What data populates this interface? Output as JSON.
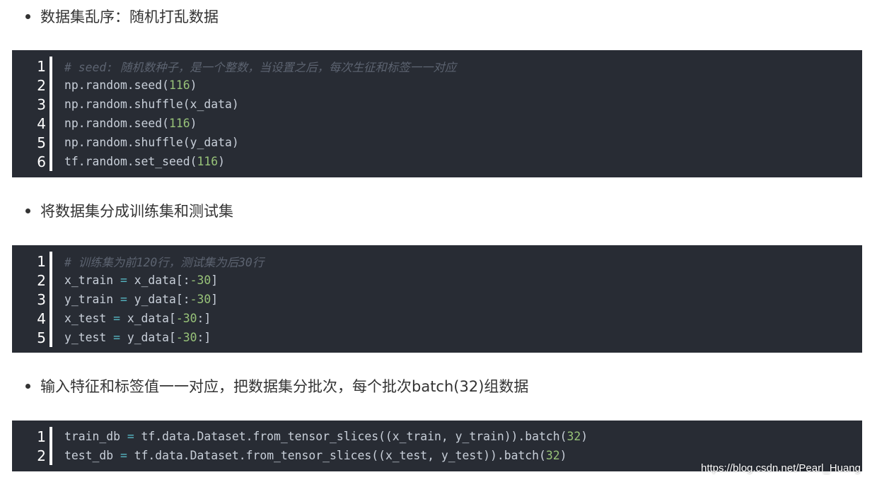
{
  "sections": [
    {
      "heading": "数据集乱序：随机打乱数据",
      "lines": [
        [
          {
            "t": "# seed: 随机数种子，是一个整数，当设置之后，每次生征和标签一一对应",
            "c": "comment"
          }
        ],
        [
          {
            "t": "np.random.seed("
          },
          {
            "t": "116",
            "c": "num"
          },
          {
            "t": ")"
          }
        ],
        [
          {
            "t": "np.random.shuffle(x_data)"
          }
        ],
        [
          {
            "t": "np.random.seed("
          },
          {
            "t": "116",
            "c": "num"
          },
          {
            "t": ")"
          }
        ],
        [
          {
            "t": "np.random.shuffle(y_data)"
          }
        ],
        [
          {
            "t": "tf.random.set_seed("
          },
          {
            "t": "116",
            "c": "num"
          },
          {
            "t": ")"
          }
        ]
      ]
    },
    {
      "heading": "将数据集分成训练集和测试集",
      "lines": [
        [
          {
            "t": "# 训练集为前120行，测试集为后30行",
            "c": "comment"
          }
        ],
        [
          {
            "t": "x_train "
          },
          {
            "t": "=",
            "c": "op"
          },
          {
            "t": " x_data[:"
          },
          {
            "t": "-30",
            "c": "num"
          },
          {
            "t": "]"
          }
        ],
        [
          {
            "t": "y_train "
          },
          {
            "t": "=",
            "c": "op"
          },
          {
            "t": " y_data[:"
          },
          {
            "t": "-30",
            "c": "num"
          },
          {
            "t": "]"
          }
        ],
        [
          {
            "t": "x_test "
          },
          {
            "t": "=",
            "c": "op"
          },
          {
            "t": " x_data["
          },
          {
            "t": "-30",
            "c": "num"
          },
          {
            "t": ":]"
          }
        ],
        [
          {
            "t": "y_test "
          },
          {
            "t": "=",
            "c": "op"
          },
          {
            "t": " y_data["
          },
          {
            "t": "-30",
            "c": "num"
          },
          {
            "t": ":]"
          }
        ]
      ]
    },
    {
      "heading": "输入特征和标签值一一对应，把数据集分批次，每个批次batch(32)组数据",
      "lines": [
        [
          {
            "t": "train_db "
          },
          {
            "t": "=",
            "c": "op"
          },
          {
            "t": " tf.data.Dataset.from_tensor_slices((x_train, y_train)).batch("
          },
          {
            "t": "32",
            "c": "num"
          },
          {
            "t": ")"
          }
        ],
        [
          {
            "t": "test_db "
          },
          {
            "t": "=",
            "c": "op"
          },
          {
            "t": " tf.data.Dataset.from_tensor_slices((x_test, y_test)).batch("
          },
          {
            "t": "32",
            "c": "num"
          },
          {
            "t": ")"
          }
        ]
      ]
    }
  ],
  "watermark": "https://blog.csdn.net/Pearl_Huang"
}
